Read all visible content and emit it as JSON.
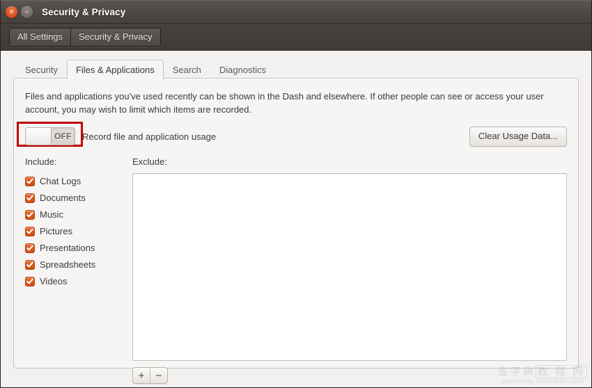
{
  "window": {
    "title": "Security & Privacy",
    "close_glyph": "✕",
    "minimize_glyph": "−"
  },
  "toolbar": {
    "buttons": [
      {
        "label": "All Settings",
        "name": "all-settings-button"
      },
      {
        "label": "Security & Privacy",
        "name": "security-privacy-button"
      }
    ]
  },
  "tabs": [
    {
      "label": "Security",
      "active": false
    },
    {
      "label": "Files & Applications",
      "active": true
    },
    {
      "label": "Search",
      "active": false
    },
    {
      "label": "Diagnostics",
      "active": false
    }
  ],
  "panel": {
    "description": "Files and applications you've used recently can be shown in the Dash and elsewhere. If other people can see or access your user account, you may wish to limit which items are recorded.",
    "switch": {
      "state_label": "OFF",
      "caption": "Record file and application usage",
      "highlight_color": "#c00000"
    },
    "clear_button_label": "Clear Usage Data...",
    "include": {
      "label": "Include:",
      "items": [
        {
          "label": "Chat Logs",
          "checked": true
        },
        {
          "label": "Documents",
          "checked": true
        },
        {
          "label": "Music",
          "checked": true
        },
        {
          "label": "Pictures",
          "checked": true
        },
        {
          "label": "Presentations",
          "checked": true
        },
        {
          "label": "Spreadsheets",
          "checked": true
        },
        {
          "label": "Videos",
          "checked": true
        }
      ]
    },
    "exclude": {
      "label": "Exclude:",
      "items": [],
      "add_label": "+",
      "remove_label": "−"
    }
  },
  "watermark": {
    "cn_part1": "查字典",
    "cn_part2": "教 程 网",
    "url": "jiaocheng.chazidian.com"
  },
  "colors": {
    "accent": "#d9571c",
    "titlebar": "#4b4743",
    "panel_bg": "#f6f5f4",
    "window_bg": "#f2f1f0"
  }
}
